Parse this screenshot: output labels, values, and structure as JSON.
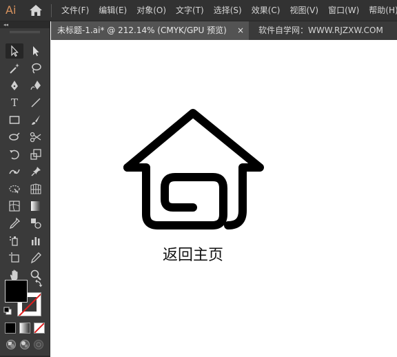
{
  "app": {
    "logo": "Ai",
    "brand_color": "#d9935e"
  },
  "menu": {
    "items": [
      "文件(F)",
      "编辑(E)",
      "对象(O)",
      "文字(T)",
      "选择(S)",
      "效果(C)",
      "视图(V)",
      "窗口(W)",
      "帮助(H)"
    ]
  },
  "tabs": {
    "document": {
      "label": "未标题-1.ai* @ 212.14% (CMYK/GPU 预览)",
      "close": "×"
    },
    "site": {
      "label": "软件自学网：WWW.RJZXW.COM"
    }
  },
  "toolbar": {
    "collapse": "◂◂",
    "type_tool_glyph": "T",
    "tools": [
      "selection-tool",
      "direct-selection-tool",
      "magic-wand-tool",
      "lasso-tool",
      "pen-tool",
      "curvature-tool",
      "type-tool",
      "line-segment-tool",
      "rectangle-tool",
      "paintbrush-tool",
      "shaper-tool",
      "scissors-tool",
      "rotate-tool",
      "scale-tool",
      "puppet-warp-tool",
      "pin-tool",
      "free-transform-tool",
      "perspective-grid-tool",
      "mesh-tool",
      "gradient-tool",
      "eyedropper-tool",
      "blend-tool",
      "symbol-sprayer-tool",
      "column-graph-tool",
      "artboard-tool",
      "slice-tool",
      "hand-tool",
      "zoom-tool"
    ],
    "fill_color": "#000000",
    "stroke_color": "none"
  },
  "canvas": {
    "artwork": "house-icon",
    "caption": "返回主页"
  }
}
